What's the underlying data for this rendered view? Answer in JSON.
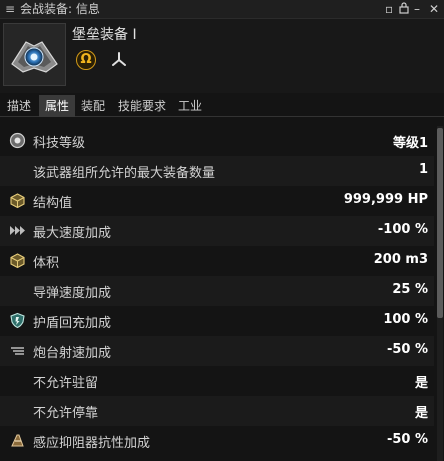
{
  "window": {
    "title": "会战装备: 信息",
    "menu_icon": "hamburger-icon",
    "buttons": [
      "minimize-icon",
      "lock-icon",
      "pin-icon",
      "close-icon"
    ],
    "expand_icon": "double-chevron-icon"
  },
  "item": {
    "name": "堡垒装备 I",
    "badge": "Ω",
    "badge_color": "#d29a18",
    "faction_icon": "triskelion-icon"
  },
  "tabs": [
    {
      "label": "描述",
      "active": false
    },
    {
      "label": "属性",
      "active": true
    },
    {
      "label": "装配",
      "active": false
    },
    {
      "label": "技能要求",
      "active": false
    },
    {
      "label": "工业",
      "active": false
    }
  ],
  "attributes": [
    {
      "icon": "tech-level-icon",
      "label": "科技等级",
      "value": "等级1"
    },
    {
      "icon": "",
      "label": "该武器组所允许的最大装备数量",
      "value": "1"
    },
    {
      "icon": "structure-icon",
      "label": "结构值",
      "value": "999,999 HP"
    },
    {
      "icon": "speed-icon",
      "label": "最大速度加成",
      "value": "-100 %"
    },
    {
      "icon": "volume-icon",
      "label": "体积",
      "value": "200 m3"
    },
    {
      "icon": "",
      "label": "导弹速度加成",
      "value": "25 %"
    },
    {
      "icon": "shield-recharge-icon",
      "label": "护盾回充加成",
      "value": "100 %"
    },
    {
      "icon": "turret-rof-icon",
      "label": "炮台射速加成",
      "value": "-50 %"
    },
    {
      "icon": "",
      "label": "不允许驻留",
      "value": "是"
    },
    {
      "icon": "",
      "label": "不允许停靠",
      "value": "是"
    },
    {
      "icon": "sensor-dampener-icon",
      "label": "感应抑阻器抗性加成",
      "value": "-50 %"
    }
  ]
}
